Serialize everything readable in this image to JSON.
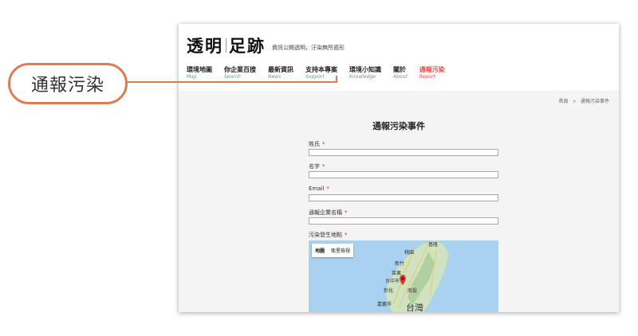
{
  "callout": {
    "label": "通報污染"
  },
  "site": {
    "logo_part1": "透明",
    "logo_part2": "足跡",
    "tagline": "資訊公開透明，汙染無所遁形"
  },
  "nav": [
    {
      "zh": "環境地圖",
      "en": "Map",
      "active": false
    },
    {
      "zh": "你企業百搜",
      "en": "Search",
      "active": false
    },
    {
      "zh": "最新資訊",
      "en": "News",
      "active": false
    },
    {
      "zh": "支持本專案",
      "en": "Support",
      "active": false
    },
    {
      "zh": "環境小知識",
      "en": "Knowledge",
      "active": false
    },
    {
      "zh": "關於",
      "en": "About",
      "active": false
    },
    {
      "zh": "通報污染",
      "en": "Report",
      "active": true
    }
  ],
  "breadcrumb": {
    "home": "首頁",
    "separator": "»",
    "current": "通報污染事件"
  },
  "form": {
    "title": "通報污染事件",
    "fields": [
      {
        "label": "姓氏",
        "required": "*",
        "value": ""
      },
      {
        "label": "名字",
        "required": "*",
        "value": ""
      },
      {
        "label": "Email",
        "required": "*",
        "value": ""
      },
      {
        "label": "通報企業名稱",
        "required": "*",
        "value": ""
      }
    ],
    "location_label": "污染發生地點",
    "location_required": "*"
  },
  "map": {
    "tab_map": "地圖",
    "tab_satellite": "衛星檢視",
    "labels": [
      "基隆",
      "桃園",
      "新竹",
      "苗栗",
      "台中市",
      "彰化",
      "嘉義市",
      "台灣",
      "南投"
    ],
    "water_color": "#a9d2f1",
    "land_color": "#cfe3c3",
    "pin_color": "#d23a2f"
  },
  "colors": {
    "accent": "#e04a4a",
    "callout_border": "#e07a52"
  }
}
